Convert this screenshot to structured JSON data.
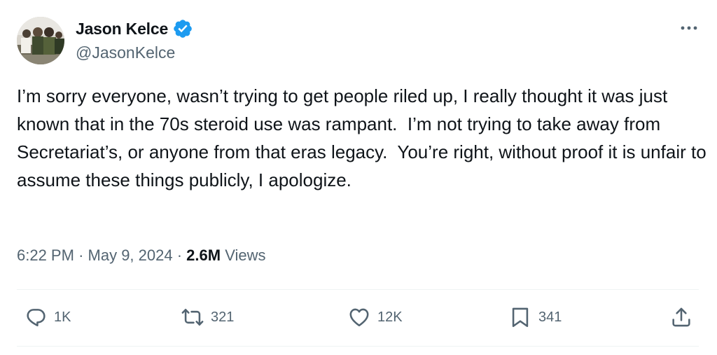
{
  "author": {
    "display_name": "Jason Kelce",
    "handle": "@JasonKelce",
    "verified": true
  },
  "tweet": {
    "text": "I’m sorry everyone, wasn’t trying to get people riled up, I really thought it was just known that in the 70s steroid use was rampant.  I’m not trying to take away from Secretariat’s, or anyone from that eras legacy.  You’re right, without proof it is unfair to assume these things publicly, I apologize.",
    "time": "6:22 PM",
    "date": "May 9, 2024",
    "separator": "·",
    "views_count": "2.6M",
    "views_label": "Views"
  },
  "actions": {
    "replies": "1K",
    "reposts": "321",
    "likes": "12K",
    "bookmarks": "341"
  },
  "colors": {
    "text_primary": "#0f1419",
    "text_secondary": "#536471",
    "verified_blue": "#1d9bf0",
    "divider": "#eff3f4"
  },
  "icons": {
    "more": "more-horizontal-icon",
    "reply": "reply-icon",
    "repost": "repost-icon",
    "like": "heart-icon",
    "bookmark": "bookmark-icon",
    "share": "share-icon"
  }
}
